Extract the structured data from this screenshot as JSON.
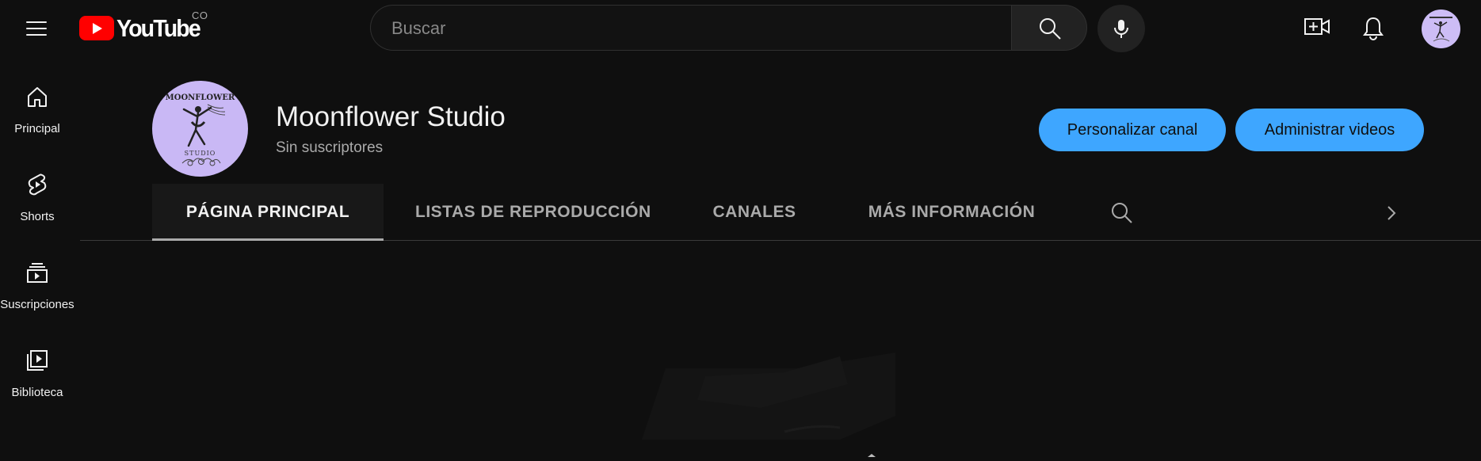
{
  "topbar": {
    "logo_text": "YouTube",
    "country_code": "CO",
    "search": {
      "placeholder": "Buscar",
      "value": ""
    },
    "icons": [
      "menu-icon",
      "search-icon",
      "mic-icon",
      "create-video-icon",
      "bell-icon"
    ]
  },
  "sidebar": {
    "items": [
      {
        "label": "Principal",
        "icon": "home-icon"
      },
      {
        "label": "Shorts",
        "icon": "shorts-icon"
      },
      {
        "label": "Suscripciones",
        "icon": "subscriptions-icon"
      },
      {
        "label": "Biblioteca",
        "icon": "library-icon"
      }
    ]
  },
  "channel": {
    "name": "Moonflower Studio",
    "subscribers": "Sin suscriptores",
    "avatar_text_top": "MOONFLOWER",
    "avatar_text_bottom": "STUDIO",
    "avatar_color": "#c9b8f5",
    "buttons": {
      "customize": "Personalizar canal",
      "manage": "Administrar videos"
    }
  },
  "tabs": [
    {
      "label": "PÁGINA PRINCIPAL",
      "active": true
    },
    {
      "label": "LISTAS DE REPRODUCCIÓN",
      "active": false
    },
    {
      "label": "CANALES",
      "active": false
    },
    {
      "label": "MÁS INFORMACIÓN",
      "active": false
    }
  ],
  "colors": {
    "background": "#0f0f0f",
    "accent_button": "#3ea6ff",
    "youtube_red": "#ff0000",
    "text_primary": "#f1f1f1",
    "text_secondary": "#aaaaaa"
  }
}
